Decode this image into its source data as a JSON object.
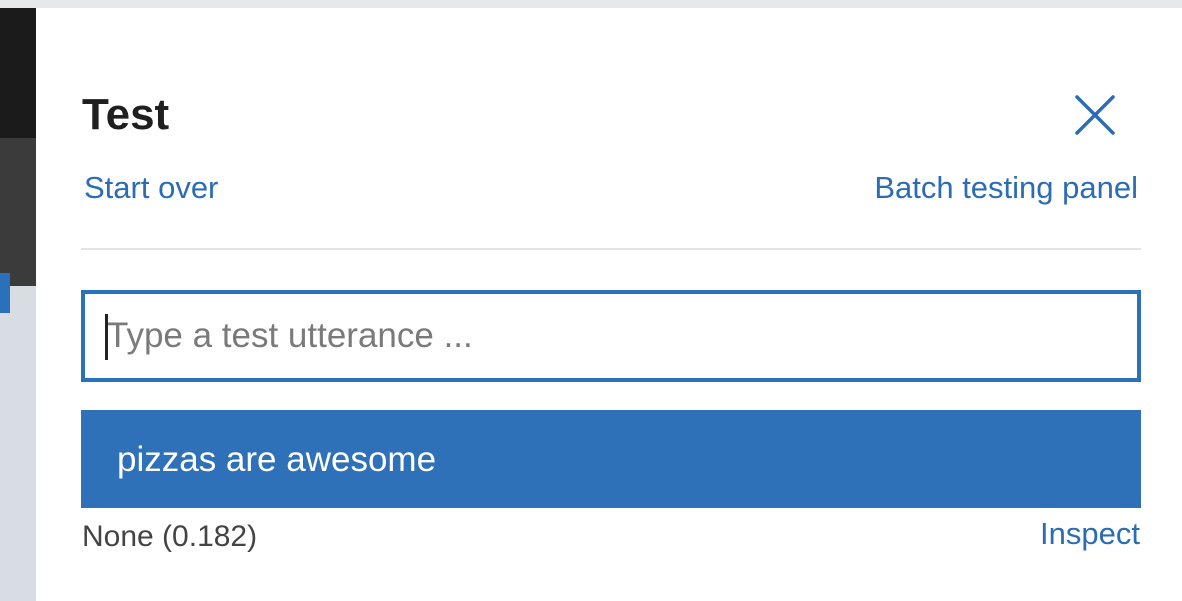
{
  "panel": {
    "title": "Test",
    "close_icon": "close-icon",
    "start_over_label": "Start over",
    "batch_testing_label": "Batch testing panel"
  },
  "input": {
    "placeholder": "Type a test utterance ...",
    "value": ""
  },
  "result": {
    "utterance": "pizzas are awesome",
    "intent": "None (0.182)",
    "inspect_label": "Inspect"
  },
  "colors": {
    "accent": "#2b70bb",
    "link": "#2b6cb5",
    "selected_bg": "#2e71b8"
  }
}
